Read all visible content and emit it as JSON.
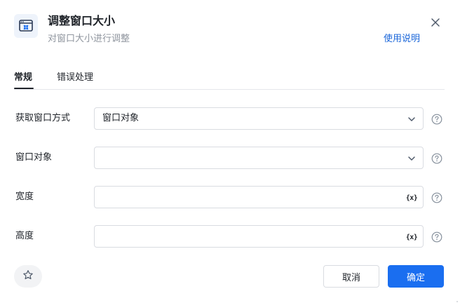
{
  "header": {
    "icon": "window-resize-icon",
    "title": "调整窗口大小",
    "subtitle": "对窗口大小进行调整",
    "help_link": "使用说明",
    "close_icon": "close-icon"
  },
  "tabs": [
    {
      "label": "常规",
      "active": true
    },
    {
      "label": "错误处理",
      "active": false
    }
  ],
  "form": {
    "rows": [
      {
        "label": "获取窗口方式",
        "value": "窗口对象",
        "trailing_icon": "chevron-down-icon",
        "help_icon": "question-icon"
      },
      {
        "label": "窗口对象",
        "value": "",
        "trailing_icon": "chevron-down-icon",
        "help_icon": "question-icon"
      },
      {
        "label": "宽度",
        "value": "",
        "trailing_icon": "variable-icon",
        "trailing_text": "{x}",
        "help_icon": "question-icon"
      },
      {
        "label": "高度",
        "value": "",
        "trailing_icon": "variable-icon",
        "trailing_text": "{x}",
        "help_icon": "question-icon"
      }
    ]
  },
  "footer": {
    "favorite_icon": "star-icon",
    "cancel_label": "取消",
    "ok_label": "确定"
  },
  "colors": {
    "accent": "#1a6ef0",
    "link": "#1a66d9",
    "border": "#d9dce1",
    "muted_text": "#8f959e"
  }
}
